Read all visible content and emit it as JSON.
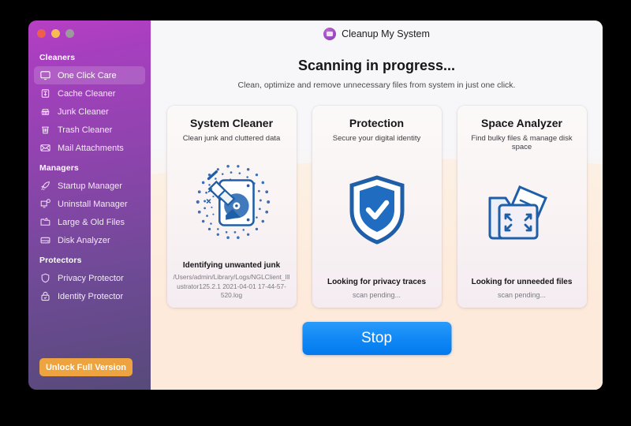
{
  "window": {
    "traffic_lights": [
      "close",
      "minimize",
      "zoom"
    ]
  },
  "sidebar": {
    "groups": [
      {
        "title": "Cleaners",
        "items": [
          {
            "label": "One Click Care",
            "icon": "monitor-icon",
            "active": true
          },
          {
            "label": "Cache Cleaner",
            "icon": "cache-icon",
            "active": false
          },
          {
            "label": "Junk Cleaner",
            "icon": "broom-icon",
            "active": false
          },
          {
            "label": "Trash Cleaner",
            "icon": "trash-icon",
            "active": false
          },
          {
            "label": "Mail Attachments",
            "icon": "mail-icon",
            "active": false
          }
        ]
      },
      {
        "title": "Managers",
        "items": [
          {
            "label": "Startup Manager",
            "icon": "rocket-icon",
            "active": false
          },
          {
            "label": "Uninstall Manager",
            "icon": "uninstall-icon",
            "active": false
          },
          {
            "label": "Large & Old Files",
            "icon": "folder-icon",
            "active": false
          },
          {
            "label": "Disk Analyzer",
            "icon": "disk-icon",
            "active": false
          }
        ]
      },
      {
        "title": "Protectors",
        "items": [
          {
            "label": "Privacy Protector",
            "icon": "shield-icon",
            "active": false
          },
          {
            "label": "Identity Protector",
            "icon": "lock-icon",
            "active": false
          }
        ]
      }
    ],
    "unlock_button": "Unlock Full Version"
  },
  "header": {
    "app_title": "Cleanup My System",
    "logo_icon": "app-logo-icon"
  },
  "main": {
    "headline": "Scanning in progress...",
    "subhead": "Clean, optimize and remove unnecessary files from system in just one click.",
    "stop_button": "Stop",
    "cards": [
      {
        "title": "System Cleaner",
        "subtitle": "Clean junk and cluttered data",
        "art_icon": "harddrive-broom-icon",
        "status": "Identifying unwanted junk",
        "detail": "/Users/admin/Library/Logs/NGLClient_Illustrator125.2.1 2021-04-01 17-44-57-520.log"
      },
      {
        "title": "Protection",
        "subtitle": "Secure your digital identity",
        "art_icon": "shield-check-icon",
        "status": "Looking for privacy traces",
        "detail": "scan pending..."
      },
      {
        "title": "Space Analyzer",
        "subtitle": "Find bulky files & manage disk space",
        "art_icon": "folder-expand-icon",
        "status": "Looking for unneeded files",
        "detail": "scan pending..."
      }
    ]
  },
  "colors": {
    "sidebar_top": "#b73fc4",
    "sidebar_bottom": "#574a7a",
    "unlock_button": "#eda33f",
    "stop_button": "#0b8af5",
    "art_blue": "#1f5fa8",
    "main_bottom": "#fdeadb"
  }
}
